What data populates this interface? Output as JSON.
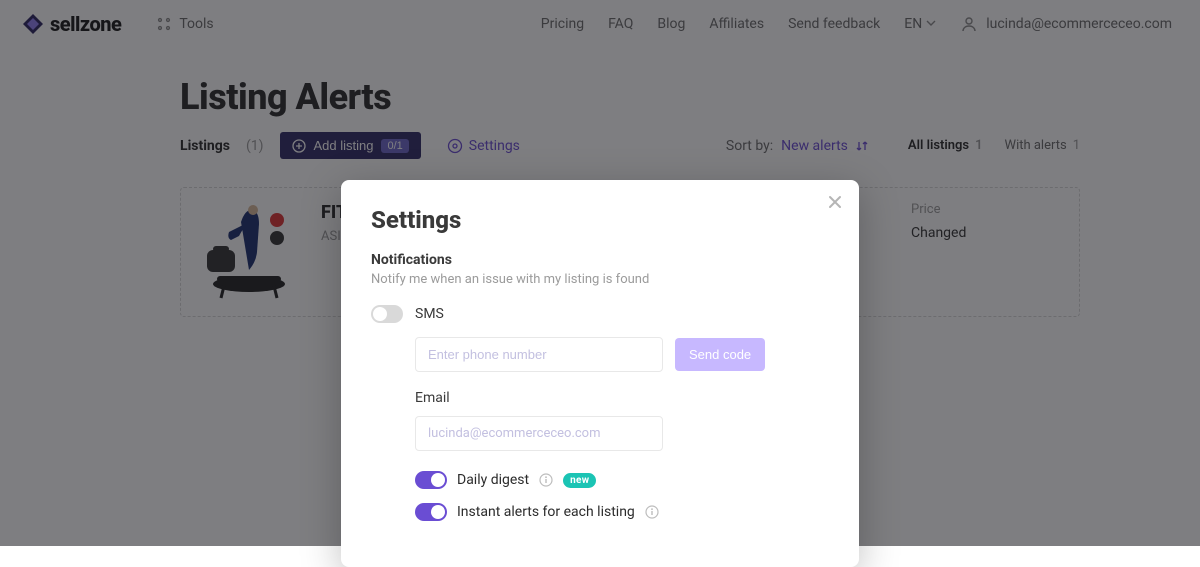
{
  "nav": {
    "brand": "sellzone",
    "tools": "Tools",
    "links": {
      "pricing": "Pricing",
      "faq": "FAQ",
      "blog": "Blog",
      "affiliates": "Affiliates",
      "feedback": "Send feedback"
    },
    "lang": "EN",
    "user_email": "lucinda@ecommerceceo.com"
  },
  "page": {
    "title": "Listing Alerts",
    "listings_label": "Listings",
    "listings_count": "(1)",
    "add_listing": "Add listing",
    "add_listing_badge": "0/1",
    "settings_link": "Settings",
    "sort_label": "Sort by:",
    "sort_value": "New alerts",
    "filters": {
      "all": {
        "label": "All listings",
        "count": "1"
      },
      "with_alerts": {
        "label": "With alerts",
        "count": "1"
      }
    },
    "card": {
      "title": "FIT",
      "asin_label": "ASIN",
      "price_label": "Price",
      "price_status": "Changed"
    }
  },
  "modal": {
    "title": "Settings",
    "section": "Notifications",
    "section_sub": "Notify me when an issue with my listing is found",
    "sms_label": "SMS",
    "phone_placeholder": "Enter phone number",
    "send_code": "Send code",
    "email_label": "Email",
    "email_value": "lucinda@ecommerceceo.com",
    "daily_digest": "Daily digest",
    "new_badge": "new",
    "instant_alerts": "Instant alerts for each listing"
  }
}
